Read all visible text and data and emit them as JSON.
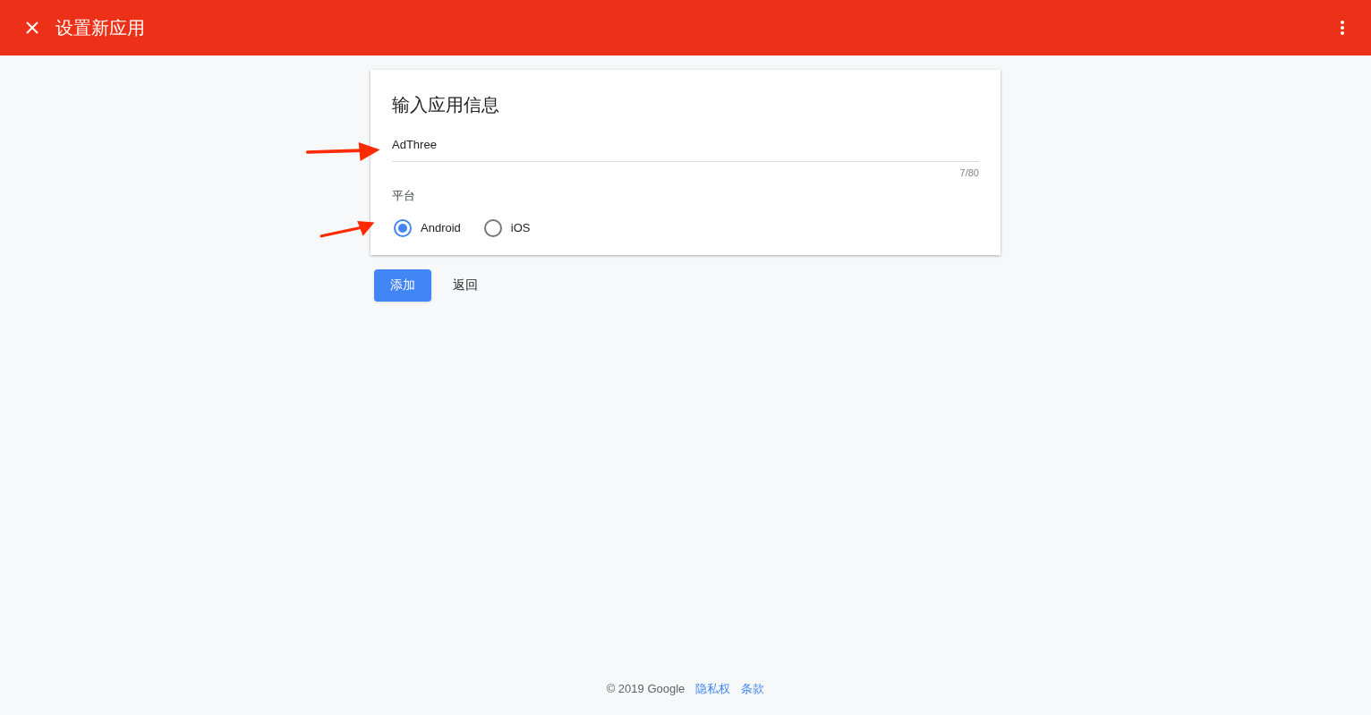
{
  "header": {
    "title": "设置新应用"
  },
  "card": {
    "title": "输入应用信息",
    "name_field": {
      "value": "AdThree",
      "counter": "7/80"
    },
    "platform_label": "平台",
    "platforms": [
      {
        "label": "Android",
        "selected": true
      },
      {
        "label": "iOS",
        "selected": false
      }
    ]
  },
  "buttons": {
    "add": "添加",
    "back": "返回"
  },
  "footer": {
    "copyright": "© 2019 Google",
    "links": [
      "隐私权",
      "条款"
    ]
  }
}
